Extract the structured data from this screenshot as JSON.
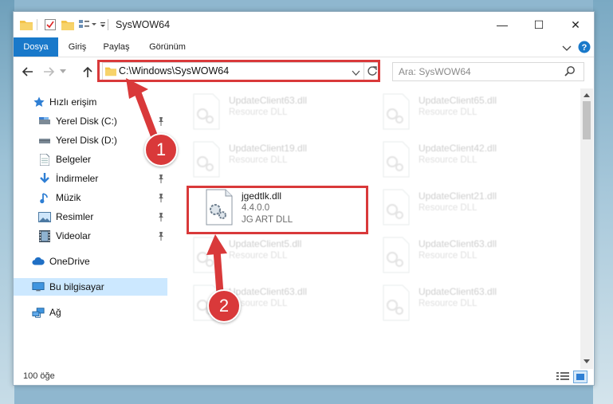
{
  "window": {
    "title": "SysWOW64",
    "minimize": "—",
    "maximize": "☐",
    "close": "✕"
  },
  "ribbon": {
    "tabs": [
      "Dosya",
      "Giriş",
      "Paylaş",
      "Görünüm"
    ]
  },
  "address": {
    "path": "C:\\Windows\\SysWOW64"
  },
  "search": {
    "placeholder": "Ara: SysWOW64"
  },
  "sidebar": {
    "quick_access": "Hızlı erişim",
    "items": [
      "Yerel Disk (C:)",
      "Yerel Disk (D:)",
      "Belgeler",
      "İndirmeler",
      "Müzik",
      "Resimler",
      "Videolar"
    ],
    "onedrive": "OneDrive",
    "this_pc": "Bu bilgisayar",
    "network": "Ağ"
  },
  "files": [
    {
      "name": "UpdateClient63.dll",
      "type": "Resource DLL"
    },
    {
      "name": "UpdateClient65.dll",
      "type": "Resource DLL"
    },
    {
      "name": "UpdateClient19.dll",
      "type": "Resource DLL"
    },
    {
      "name": "UpdateClient42.dll",
      "type": "Resource DLL"
    },
    {
      "name": "jgedtlk.dll",
      "version": "4.4.0.0",
      "type": "JG ART DLL"
    },
    {
      "name": "UpdateClient21.dll",
      "type": "Resource DLL"
    },
    {
      "name": "UpdateClient5.dll",
      "type": "Resource DLL"
    },
    {
      "name": "UpdateClient63.dll",
      "type": "Resource DLL"
    },
    {
      "name": "UpdateClient63.dll",
      "type": "Resource DLL"
    },
    {
      "name": "UpdateClient63.dll",
      "type": "Resource DLL"
    }
  ],
  "status": {
    "count": "100 öğe"
  },
  "annotations": {
    "step1": "1",
    "step2": "2",
    "color": "#d9393a"
  }
}
